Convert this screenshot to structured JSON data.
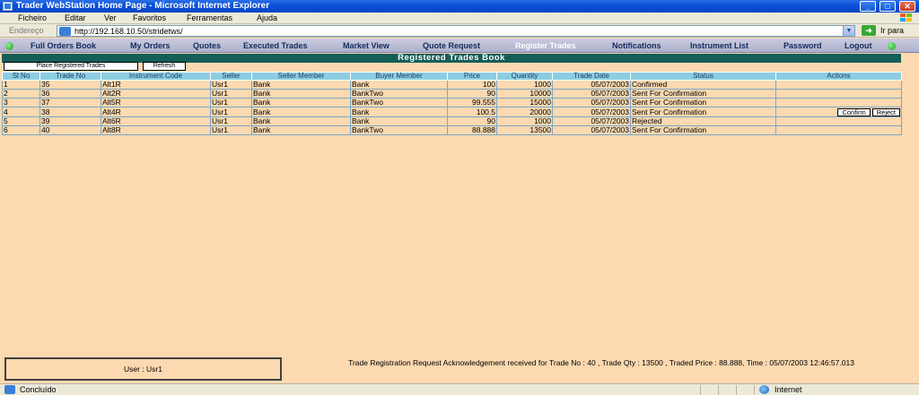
{
  "window": {
    "title": "Trader WebStation Home Page - Microsoft Internet Explorer",
    "minimize": "_",
    "maximize": "□",
    "close": "✕"
  },
  "menu": [
    "Ficheiro",
    "Editar",
    "Ver",
    "Favoritos",
    "Ferramentas",
    "Ajuda"
  ],
  "address": {
    "label": "Endereço",
    "url": "http://192.168.10.50/stridetws/",
    "go_label": "Ir para",
    "go_arrow": "➜"
  },
  "nav": {
    "items": [
      "Full Orders Book",
      "My Orders",
      "Quotes",
      "Executed Trades",
      "Market View",
      "Quote Request",
      "Register Trades",
      "Notifications",
      "Instrument List",
      "Password",
      "Logout"
    ],
    "active": "Register Trades"
  },
  "section": {
    "title": "Registered Trades Book",
    "place_button": "Place Registered Trades",
    "refresh_button": "Refresh"
  },
  "table": {
    "headers": [
      "Sl No",
      "Trade No",
      "Instrument Code",
      "Seller",
      "Seller Member",
      "Buyer Member",
      "Price",
      "Quantity",
      "Trade Date",
      "Status",
      "Actions"
    ],
    "rows": [
      {
        "sl": "1",
        "trade_no": "35",
        "instrument": "Alt1R",
        "seller": "Usr1",
        "seller_member": "Bank",
        "buyer_member": "Bank",
        "price": "100",
        "quantity": "1000",
        "trade_date": "05/07/2003",
        "status": "Confirmed",
        "actions": []
      },
      {
        "sl": "2",
        "trade_no": "36",
        "instrument": "Alt2R",
        "seller": "Usr1",
        "seller_member": "Bank",
        "buyer_member": "BankTwo",
        "price": "90",
        "quantity": "10000",
        "trade_date": "05/07/2003",
        "status": "Sent For Confirmation",
        "actions": []
      },
      {
        "sl": "3",
        "trade_no": "37",
        "instrument": "Alt5R",
        "seller": "Usr1",
        "seller_member": "Bank",
        "buyer_member": "BankTwo",
        "price": "99.555",
        "quantity": "15000",
        "trade_date": "05/07/2003",
        "status": "Sent For Confirmation",
        "actions": []
      },
      {
        "sl": "4",
        "trade_no": "38",
        "instrument": "Alt4R",
        "seller": "Usr1",
        "seller_member": "Bank",
        "buyer_member": "Bank",
        "price": "100.5",
        "quantity": "20000",
        "trade_date": "05/07/2003",
        "status": "Sent For Confirmation",
        "actions": [
          "Confirm",
          "Reject"
        ]
      },
      {
        "sl": "5",
        "trade_no": "39",
        "instrument": "Alt6R",
        "seller": "Usr1",
        "seller_member": "Bank",
        "buyer_member": "Bank",
        "price": "90",
        "quantity": "1000",
        "trade_date": "05/07/2003",
        "status": "Rejected",
        "actions": []
      },
      {
        "sl": "6",
        "trade_no": "40",
        "instrument": "Alt8R",
        "seller": "Usr1",
        "seller_member": "Bank",
        "buyer_member": "BankTwo",
        "price": "88.888",
        "quantity": "13500",
        "trade_date": "05/07/2003",
        "status": "Sent For Confirmation",
        "actions": []
      }
    ]
  },
  "footer": {
    "user": "User : Usr1",
    "message": "Trade Registration Request Acknowledgement received for Trade No : 40 , Trade Qty : 13500 , Traded Price : 88.888, Time : 05/07/2003 12:46:57.013"
  },
  "statusbar": {
    "left": "Concluído",
    "zone": "Internet"
  },
  "colors": {
    "page_bg": "#FCD9B0",
    "section_header": "#155E57",
    "table_header": "#8CCDE2",
    "nav_bg": "#B8BBD4",
    "active_nav": "#FFFFFF"
  }
}
